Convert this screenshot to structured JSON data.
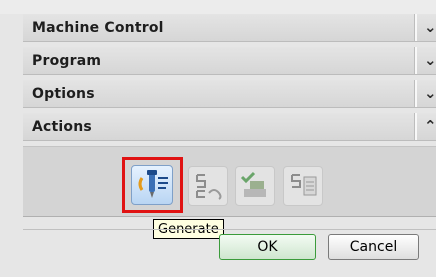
{
  "sections": [
    {
      "label": "Machine Control",
      "state": "collapsed",
      "icon": "chevron-down-icon"
    },
    {
      "label": "Program",
      "state": "collapsed",
      "icon": "chevron-down-icon"
    },
    {
      "label": "Options",
      "state": "collapsed",
      "icon": "chevron-down-icon"
    },
    {
      "label": "Actions",
      "state": "expanded",
      "icon": "chevron-up-icon"
    }
  ],
  "actions": {
    "tools": [
      {
        "name": "generate-icon",
        "highlighted": true
      },
      {
        "name": "replay-icon",
        "highlighted": false
      },
      {
        "name": "verify-icon",
        "highlighted": false
      },
      {
        "name": "list-icon",
        "highlighted": false
      }
    ],
    "tooltip": "Generate"
  },
  "buttons": {
    "ok_label": "OK",
    "cancel_label": "Cancel"
  },
  "colors": {
    "highlight_border": "#e01212",
    "ok_border": "#3b9b3b",
    "tooltip_bg": "#ffffe1"
  }
}
